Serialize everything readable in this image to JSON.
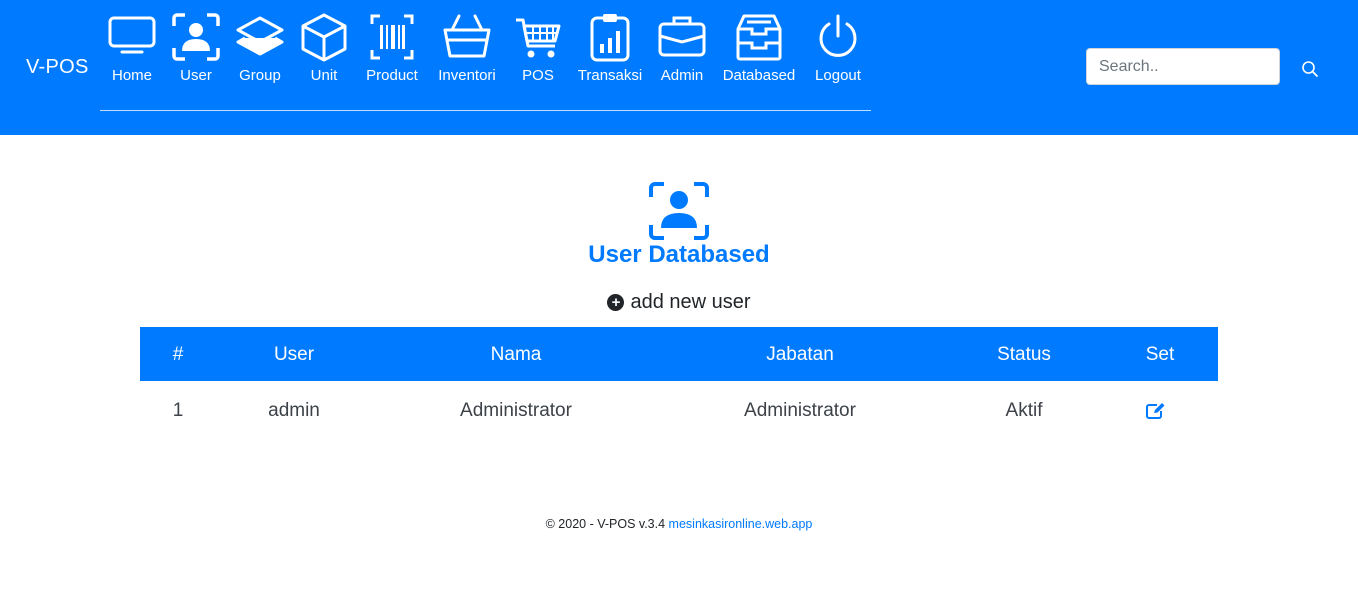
{
  "brand": "V-POS",
  "nav": [
    {
      "label": "Home",
      "icon": "monitor-icon"
    },
    {
      "label": "User",
      "icon": "user-scan-icon"
    },
    {
      "label": "Group",
      "icon": "layers-icon"
    },
    {
      "label": "Unit",
      "icon": "box-icon"
    },
    {
      "label": "Product",
      "icon": "barcode-icon"
    },
    {
      "label": "Inventori",
      "icon": "basket-icon"
    },
    {
      "label": "POS",
      "icon": "cart-icon"
    },
    {
      "label": "Transaksi",
      "icon": "clipboard-chart-icon"
    },
    {
      "label": "Admin",
      "icon": "briefcase-icon"
    },
    {
      "label": "Databased",
      "icon": "archive-icon"
    },
    {
      "label": "Logout",
      "icon": "power-icon"
    }
  ],
  "search": {
    "placeholder": "Search..",
    "value": ""
  },
  "page": {
    "title": "User Databased",
    "add_label": "add new user"
  },
  "table": {
    "headers": [
      "#",
      "User",
      "Nama",
      "Jabatan",
      "Status",
      "Set"
    ],
    "rows": [
      {
        "no": "1",
        "user": "admin",
        "nama": "Administrator",
        "jabatan": "Administrator",
        "status": "Aktif"
      }
    ]
  },
  "footer": {
    "text": "© 2020 - V-POS v.3.4",
    "link": "mesinkasironline.web.app"
  },
  "colors": {
    "primary": "#007bff",
    "text": "#212529"
  }
}
